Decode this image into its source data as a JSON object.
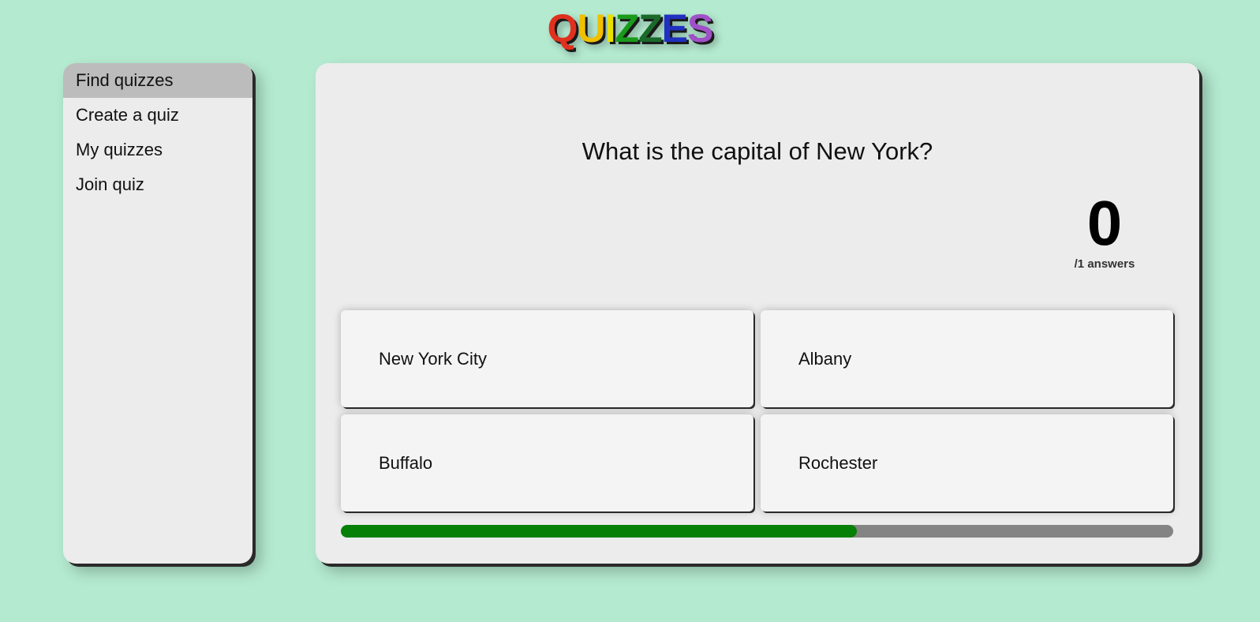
{
  "logo": {
    "letters": [
      {
        "char": "Q",
        "color": "#e0301e"
      },
      {
        "char": "U",
        "color": "#f0c000"
      },
      {
        "char": "I",
        "color": "#e8e000"
      },
      {
        "char": "Z",
        "color": "#1a9a1a"
      },
      {
        "char": "Z",
        "color": "#1a6a2a"
      },
      {
        "char": "E",
        "color": "#2030c0"
      },
      {
        "char": "S",
        "color": "#a050c8"
      }
    ]
  },
  "sidebar": {
    "items": [
      {
        "label": "Find quizzes",
        "active": true
      },
      {
        "label": "Create a quiz",
        "active": false
      },
      {
        "label": "My quizzes",
        "active": false
      },
      {
        "label": "Join quiz",
        "active": false
      }
    ]
  },
  "quiz": {
    "question": "What is the capital of New York?",
    "answer_count": "0",
    "answer_count_label": "/1 answers",
    "answers": [
      "New York City",
      "Albany",
      "Buffalo",
      "Rochester"
    ],
    "timer_progress": 0.62
  },
  "colors": {
    "background": "#b4ead0",
    "panel": "#ececec",
    "active_item": "#bcbcbc",
    "progress_fill": "#068006",
    "progress_track": "#848484"
  }
}
